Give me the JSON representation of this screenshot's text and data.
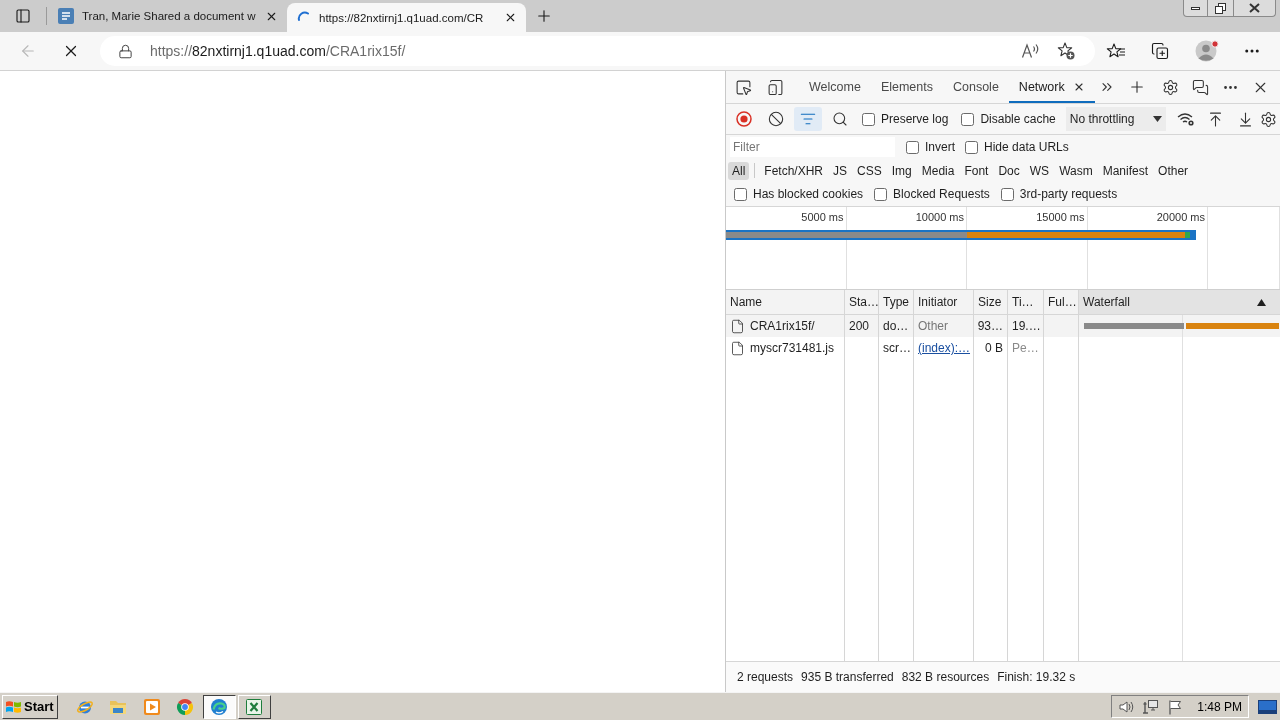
{
  "browser": {
    "tabs": [
      {
        "title": "Tran, Marie Shared a document w",
        "selected": false,
        "loading": false
      },
      {
        "title": "https://82nxtirnj1.q1uad.com/CR",
        "selected": true,
        "loading": true
      }
    ],
    "back_disabled": true,
    "loading": true,
    "address": {
      "scheme": "https://",
      "host": "82nxtirnj1.q1uad.com",
      "path": "/CRA1rix15f/"
    }
  },
  "devtools": {
    "panel_tabs": [
      {
        "label": "Welcome",
        "selected": false,
        "closable": false
      },
      {
        "label": "Elements",
        "selected": false,
        "closable": false
      },
      {
        "label": "Console",
        "selected": false,
        "closable": false
      },
      {
        "label": "Network",
        "selected": true,
        "closable": true
      }
    ],
    "recording": true,
    "filter_shown": true,
    "toolbar_options": [
      {
        "label": "Preserve log",
        "checked": false
      },
      {
        "label": "Disable cache",
        "checked": false
      }
    ],
    "throttling": "No throttling",
    "filter": {
      "placeholder": "Filter",
      "options": [
        {
          "label": "Invert",
          "checked": false
        },
        {
          "label": "Hide data URLs",
          "checked": false
        }
      ]
    },
    "type_filters": [
      {
        "label": "All",
        "selected": true
      },
      {
        "label": "Fetch/XHR",
        "selected": false
      },
      {
        "label": "JS",
        "selected": false
      },
      {
        "label": "CSS",
        "selected": false
      },
      {
        "label": "Img",
        "selected": false
      },
      {
        "label": "Media",
        "selected": false
      },
      {
        "label": "Font",
        "selected": false
      },
      {
        "label": "Doc",
        "selected": false
      },
      {
        "label": "WS",
        "selected": false
      },
      {
        "label": "Wasm",
        "selected": false
      },
      {
        "label": "Manifest",
        "selected": false
      },
      {
        "label": "Other",
        "selected": false
      }
    ],
    "blocked_filters": [
      {
        "label": "Has blocked cookies",
        "checked": false
      },
      {
        "label": "Blocked Requests",
        "checked": false
      },
      {
        "label": "3rd-party requests",
        "checked": false
      }
    ],
    "overview": {
      "ticks": [
        "5000 ms",
        "10000 ms",
        "15000 ms",
        "20000 ms"
      ]
    },
    "table": {
      "columns": [
        {
          "label": "Name",
          "sorted": false
        },
        {
          "label": "Sta…",
          "sorted": false
        },
        {
          "label": "Type",
          "sorted": false
        },
        {
          "label": "Initiator",
          "sorted": false
        },
        {
          "label": "Size",
          "sorted": false
        },
        {
          "label": "Ti…",
          "sorted": false
        },
        {
          "label": "Ful…",
          "sorted": false
        },
        {
          "label": "Waterfall",
          "sorted": true
        }
      ],
      "rows": [
        {
          "name": "CRA1rix15f/",
          "status": "200",
          "type": "do…",
          "initiator": {
            "text": "Other",
            "kind": "plain"
          },
          "size": "93…",
          "time": "19.…",
          "pending": false
        },
        {
          "name": "myscr731481.js",
          "type": "scr…",
          "initiator": {
            "text": "(index):…",
            "kind": "link"
          },
          "size": "0 B",
          "time": "Pe…",
          "pending": true
        }
      ]
    },
    "summary": [
      "2 requests",
      "935 B transferred",
      "832 B resources",
      "Finish: 19.32 s"
    ]
  },
  "taskbar": {
    "start": "Start",
    "apps": [
      {
        "kind": "ie",
        "running": false,
        "selected": false
      },
      {
        "kind": "explorer",
        "running": false,
        "selected": false
      },
      {
        "kind": "media",
        "running": false,
        "selected": false
      },
      {
        "kind": "chrome",
        "running": false,
        "selected": false
      },
      {
        "kind": "edge",
        "running": true,
        "selected": true
      },
      {
        "kind": "excel",
        "running": true,
        "selected": false
      }
    ],
    "clock": "1:48 PM"
  }
}
